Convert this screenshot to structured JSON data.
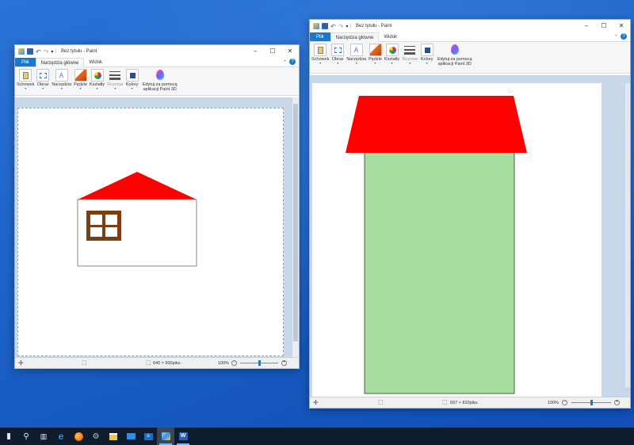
{
  "windows": [
    {
      "id": "left",
      "title": "Bez tytułu - Paint",
      "tabs": {
        "file": "Plik",
        "home": "Narzędzia główne",
        "view": "Widok"
      },
      "ribbon": [
        {
          "key": "clipboard",
          "label": "Schowek",
          "icon": "clipboard-icon",
          "dim": false
        },
        {
          "key": "image",
          "label": "Obraz",
          "icon": "image-select-icon",
          "dim": false
        },
        {
          "key": "tools",
          "label": "Narzędzia",
          "icon": "tools-icon",
          "dim": false
        },
        {
          "key": "brushes",
          "label": "Pędzle",
          "icon": "brush-icon",
          "dim": false
        },
        {
          "key": "shapes",
          "label": "Kształty",
          "icon": "shapes-icon",
          "dim": false
        },
        {
          "key": "size",
          "label": "Rozmiar",
          "icon": "line-size-icon",
          "dim": true
        },
        {
          "key": "colors",
          "label": "Kolory",
          "icon": "palette-icon",
          "dim": false
        },
        {
          "key": "paint3d",
          "label": "Edytuj za pomocą aplikacji Paint 3D",
          "icon": "paint3d-icon",
          "dim": false
        }
      ],
      "status": {
        "dimensions": "640 × 600piks.",
        "zoom": "100%"
      },
      "zoom_level": 0.5
    },
    {
      "id": "right",
      "title": "Bez tytułu - Paint",
      "tabs": {
        "file": "Plik",
        "home": "Narzędzia główne",
        "view": "Widok"
      },
      "ribbon": [
        {
          "key": "clipboard",
          "label": "Schowek",
          "icon": "clipboard-icon",
          "dim": false
        },
        {
          "key": "image",
          "label": "Obraz",
          "icon": "image-select-icon",
          "dim": false
        },
        {
          "key": "tools",
          "label": "Narzędzia",
          "icon": "tools-icon",
          "dim": false
        },
        {
          "key": "brushes",
          "label": "Pędzle",
          "icon": "brush-icon",
          "dim": false
        },
        {
          "key": "shapes",
          "label": "Kształty",
          "icon": "shapes-icon",
          "dim": false
        },
        {
          "key": "size",
          "label": "Rozmiar",
          "icon": "line-size-icon",
          "dim": true
        },
        {
          "key": "colors",
          "label": "Kolory",
          "icon": "palette-icon",
          "dim": false
        },
        {
          "key": "paint3d",
          "label": "Edytuj za pomocą aplikacji Paint 3D",
          "icon": "paint3d-icon",
          "dim": false
        }
      ],
      "status": {
        "dimensions": "697 × 810piks.",
        "zoom": "100%"
      },
      "zoom_level": 0.5
    }
  ],
  "drawings": {
    "left": {
      "roof_color": "#ff0000",
      "house_wall_color": "#ffffff",
      "window_frame_color": "#7b3f12",
      "window_pane_color": "#ffffff"
    },
    "right": {
      "roof_color": "#ff0000",
      "tower_color": "#a8dda0"
    }
  },
  "taskbar": {
    "items": [
      "start-icon",
      "search-icon",
      "task-view-icon",
      "edge-icon",
      "firefox-icon",
      "settings-icon",
      "store-icon",
      "mail-icon",
      "outlook-icon",
      "paint-icon",
      "word-icon"
    ]
  }
}
